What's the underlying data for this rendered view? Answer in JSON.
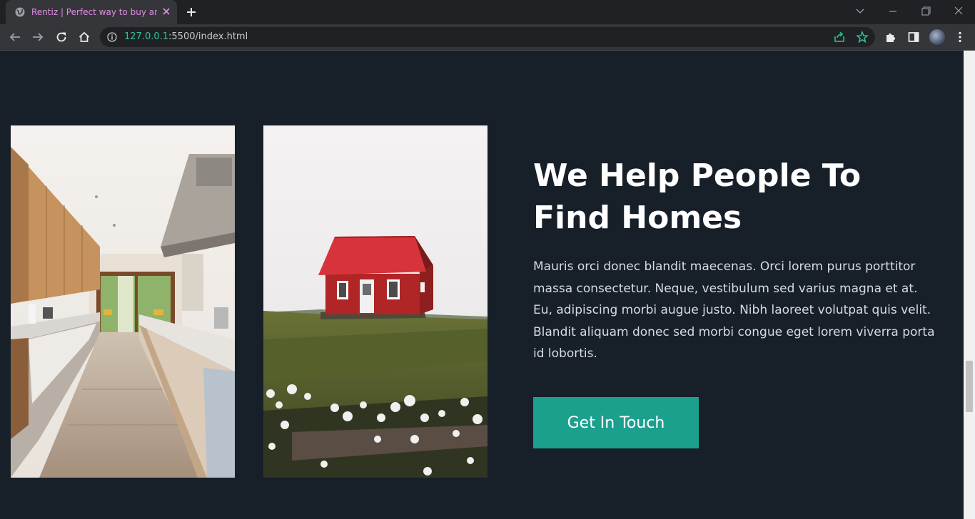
{
  "browser": {
    "tab_title": "Rentiz | Perfect way to buy and sell",
    "url_host": "127.0.0.1",
    "url_path": ":5500/index.html"
  },
  "about": {
    "heading_line1": "We Help People To",
    "heading_line2": "Find Homes",
    "paragraph": "Mauris orci donec blandit maecenas. Orci lorem purus porttitor massa consectetur. Neque, vestibulum sed varius magna et at. Eu, adipiscing morbi augue justo. Nibh laoreet volutpat quis velit. Blandit aliquam donec sed morbi congue eget lorem viverra porta id lobortis.",
    "button_label": "Get In Touch"
  },
  "icons": {
    "tab_favicon": "globe-icon",
    "tab_close": "close-icon",
    "new_tab": "plus-icon",
    "back": "back-arrow-icon",
    "forward": "forward-arrow-icon",
    "reload": "reload-icon",
    "home": "home-icon",
    "site_info": "info-icon",
    "share": "share-icon",
    "bookmark": "star-icon",
    "extensions": "puzzle-icon",
    "side_panel": "side-panel-icon",
    "menu": "kebab-menu-icon"
  },
  "colors": {
    "page_background": "#171f29",
    "button_background": "#1ba08e",
    "url_host": "#31c59a",
    "tab_title": "#e58be8"
  }
}
